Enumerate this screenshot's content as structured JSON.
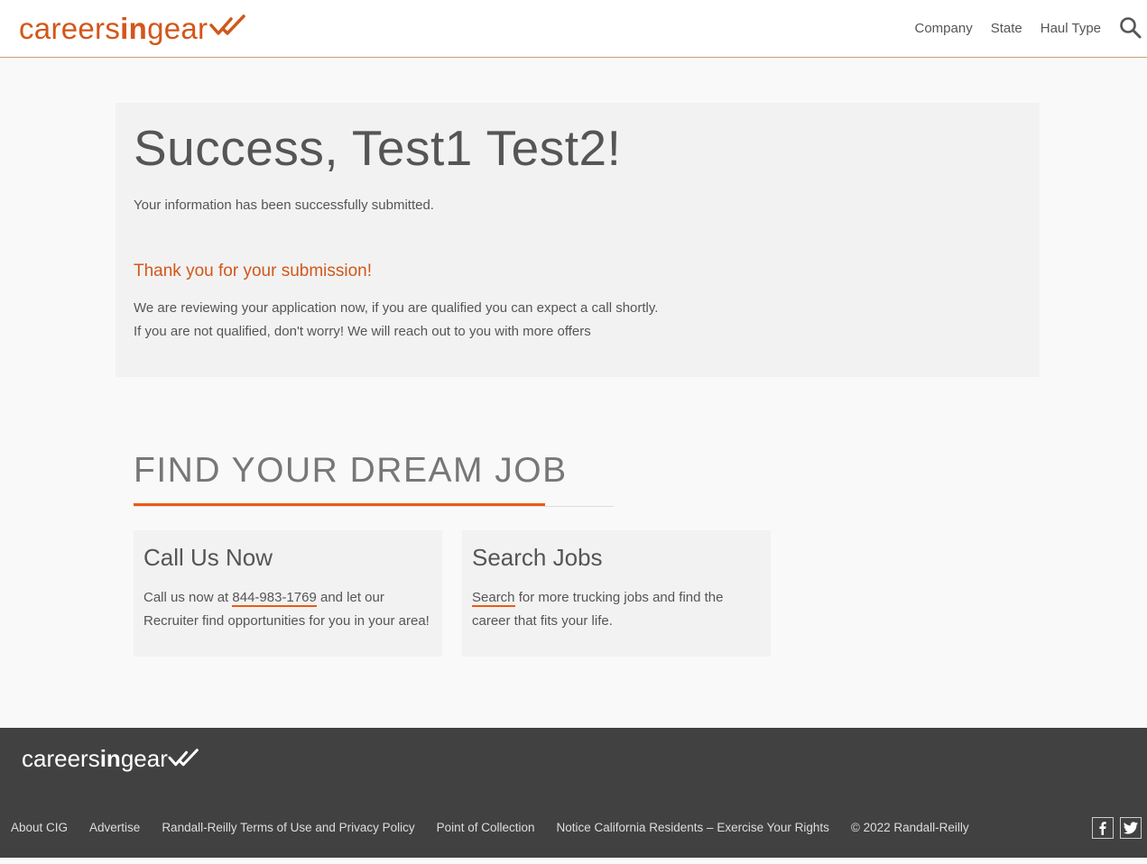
{
  "header": {
    "logo": {
      "pre": "careers",
      "mid": "in",
      "post": "gear"
    },
    "nav": [
      "Company",
      "State",
      "Haul Type"
    ]
  },
  "success": {
    "title": "Success, Test1 Test2!",
    "info": "Your information has been successfully submitted.",
    "thanks": "Thank you for your submission!",
    "line1": "We are reviewing your application now, if you are qualified you can expect a call shortly.",
    "line2": "If you are not qualified, don't worry! We will reach out to you with more offers"
  },
  "dream": {
    "title": "FIND YOUR DREAM JOB",
    "call": {
      "title": "Call Us Now",
      "text_before": "Call us now at ",
      "phone": "844-983-1769",
      "text_after": " and let our Recruiter find opportunities for you in your area!"
    },
    "search": {
      "title": "Search Jobs",
      "link": "Search",
      "text_after": " for more trucking jobs and find the career that fits your life."
    }
  },
  "footer": {
    "logo": {
      "pre": "careers",
      "mid": "in",
      "post": "gear"
    },
    "links": [
      "About CIG",
      "Advertise",
      "Randall-Reilly Terms of Use and Privacy Policy",
      "Point of Collection",
      "Notice California Residents – Exercise Your Rights"
    ],
    "copyright": "© 2022 Randall-Reilly"
  },
  "colors": {
    "brand_orange": "#d2571a",
    "accent_orange": "#e85c14",
    "footer_bg": "#414141"
  },
  "icons": [
    "logo-check-icon",
    "search-icon",
    "facebook-icon",
    "twitter-icon"
  ]
}
